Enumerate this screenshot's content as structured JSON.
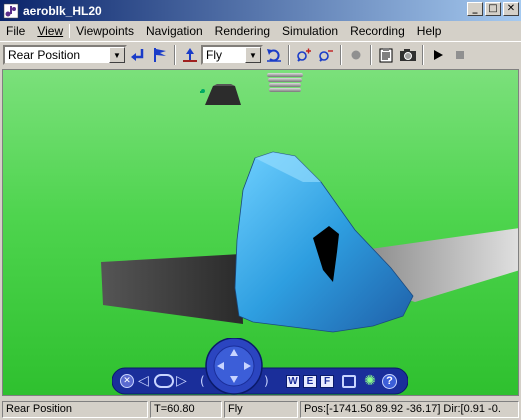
{
  "window": {
    "title": "aeroblk_HL20"
  },
  "menu": {
    "items": [
      "File",
      "View",
      "Viewpoints",
      "Navigation",
      "Rendering",
      "Simulation",
      "Recording",
      "Help"
    ]
  },
  "toolbar": {
    "viewpoint_value": "Rear Position",
    "nav_mode_value": "Fly"
  },
  "status": {
    "viewpoint": "Rear Position",
    "time": "T=60.80",
    "mode": "Fly",
    "position": "Pos:[-1741.50 89.92 -36.17] Dir:[0.91 -0."
  },
  "nav_panel": {
    "walk_label": "W",
    "examine_label": "E",
    "fly_label": "F",
    "help_label": "?"
  },
  "colors": {
    "sky_ground": "#3cd43c",
    "aircraft_body": "#2e9ee0",
    "nav_panel": "#1a2e9a"
  }
}
